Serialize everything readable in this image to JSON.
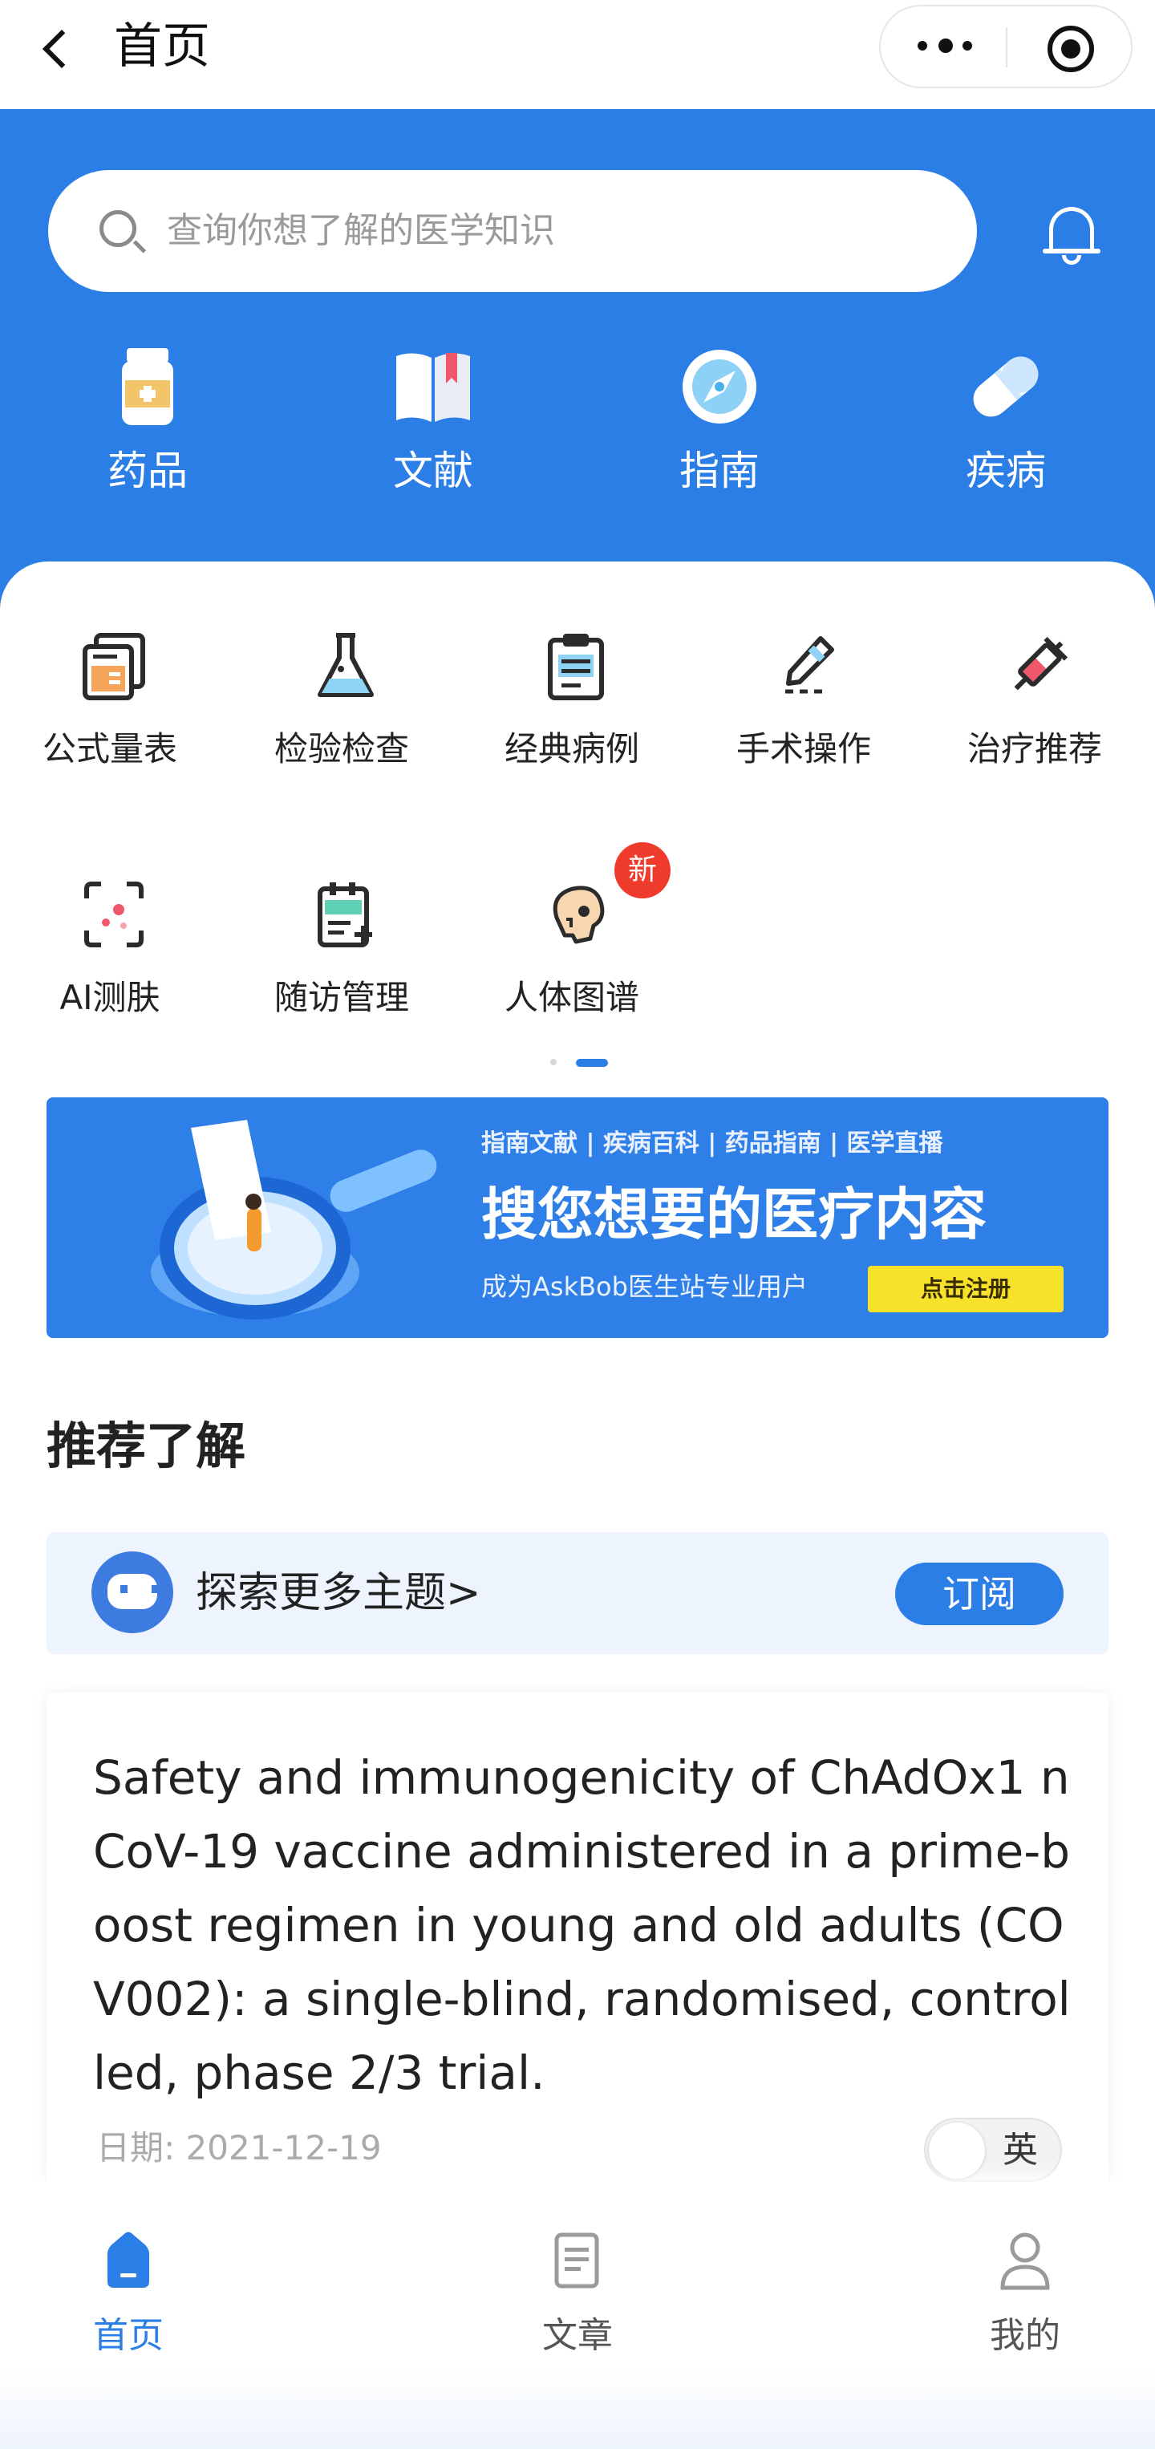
{
  "nav": {
    "title": "首页"
  },
  "search": {
    "placeholder": "查询你想了解的医学知识"
  },
  "categories": [
    {
      "label": "药品",
      "icon": "medicine-bottle-icon"
    },
    {
      "label": "文献",
      "icon": "book-icon"
    },
    {
      "label": "指南",
      "icon": "compass-icon"
    },
    {
      "label": "疾病",
      "icon": "capsule-icon"
    }
  ],
  "tools": [
    {
      "label": "公式量表",
      "icon": "formula-card-icon"
    },
    {
      "label": "检验检查",
      "icon": "flask-icon"
    },
    {
      "label": "经典病例",
      "icon": "clipboard-icon"
    },
    {
      "label": "手术操作",
      "icon": "scalpel-icon"
    },
    {
      "label": "治疗推荐",
      "icon": "syringe-icon"
    },
    {
      "label": "AI测肤",
      "icon": "face-scan-icon"
    },
    {
      "label": "随访管理",
      "icon": "followup-notes-icon"
    },
    {
      "label": "人体图谱",
      "icon": "skull-icon"
    }
  ],
  "new_badge": "新",
  "banner": {
    "tabs": "指南文献 | 疾病百科 | 药品指南 | 医学直播",
    "headline": "搜您想要的医疗内容",
    "subline": "成为AskBob医生站专业用户",
    "cta": "点击注册"
  },
  "recommend": {
    "title": "推荐了解",
    "explore_label": "探索更多主题>",
    "subscribe": "订阅"
  },
  "article": {
    "title": "Safety and immunogenicity of ChAdOx1 nCoV-19 vaccine administered in a prime-boost regimen in young and old adults (COV002): a single-blind, randomised, controlled, phase 2/3 trial.",
    "date": "日期: 2021-12-19",
    "lang_toggle": "英"
  },
  "tabbar": [
    {
      "label": "首页",
      "icon": "home-icon",
      "active": true
    },
    {
      "label": "文章",
      "icon": "article-icon",
      "active": false
    },
    {
      "label": "我的",
      "icon": "profile-icon",
      "active": false
    }
  ],
  "colors": {
    "brand": "#2a7ee6",
    "badge": "#ef3b2c",
    "cta": "#f6e12b"
  }
}
